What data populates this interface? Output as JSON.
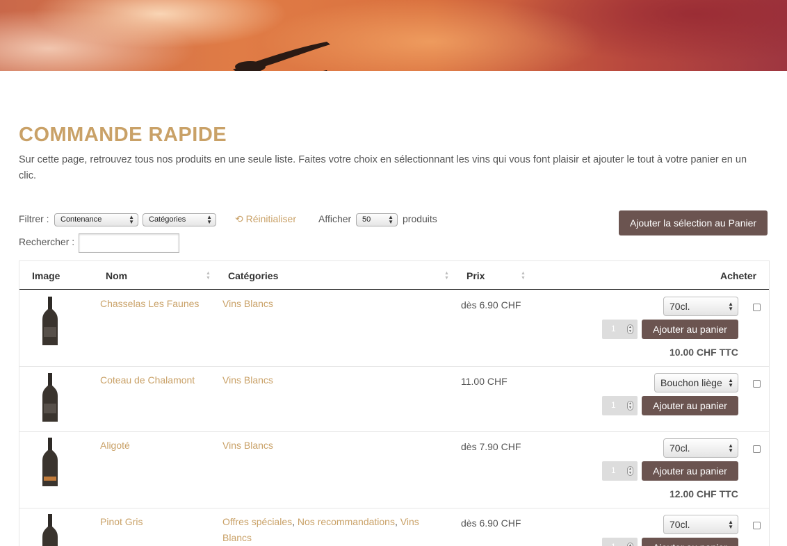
{
  "page": {
    "title": "COMMANDE RAPIDE",
    "intro": "Sur cette page, retrouvez tous nos produits en une seule liste. Faites votre choix en sélectionnant les vins qui vous font plaisir et ajouter le tout à votre panier en un clic."
  },
  "toolbar": {
    "filter_label": "Filtrer :",
    "filter_contenance": "Contenance",
    "filter_categories": "Catégories",
    "reset_label": "Réinitialiser",
    "show_label": "Afficher",
    "show_value": "50",
    "show_suffix": "produits",
    "search_label": "Rechercher :",
    "search_value": "",
    "add_selection_label": "Ajouter la sélection au Panier"
  },
  "table": {
    "headers": {
      "image": "Image",
      "name": "Nom",
      "categories": "Catégories",
      "price": "Prix",
      "buy": "Acheter"
    },
    "add_to_cart_label": "Ajouter au panier",
    "rows": [
      {
        "name": "Chasselas Les Faunes",
        "categories": [
          "Vins Blancs"
        ],
        "price": "dès 6.90 CHF",
        "option": "70cl.",
        "quantity": "1",
        "total": "10.00 CHF TTC"
      },
      {
        "name": "Coteau de Chalamont",
        "categories": [
          "Vins Blancs"
        ],
        "price": "11.00 CHF",
        "option": "Bouchon liège",
        "quantity": "1",
        "total": ""
      },
      {
        "name": "Aligoté",
        "categories": [
          "Vins Blancs"
        ],
        "price": "dès 7.90 CHF",
        "option": "70cl.",
        "quantity": "1",
        "total": "12.00 CHF TTC"
      },
      {
        "name": "Pinot Gris",
        "categories": [
          "Offres spéciales",
          "Nos recommandations",
          "Vins",
          "Blancs"
        ],
        "price": "dès 6.90 CHF",
        "option": "70cl.",
        "quantity": "1",
        "total": ""
      }
    ]
  },
  "colors": {
    "accent": "#c9a167",
    "button": "#6b5450"
  }
}
